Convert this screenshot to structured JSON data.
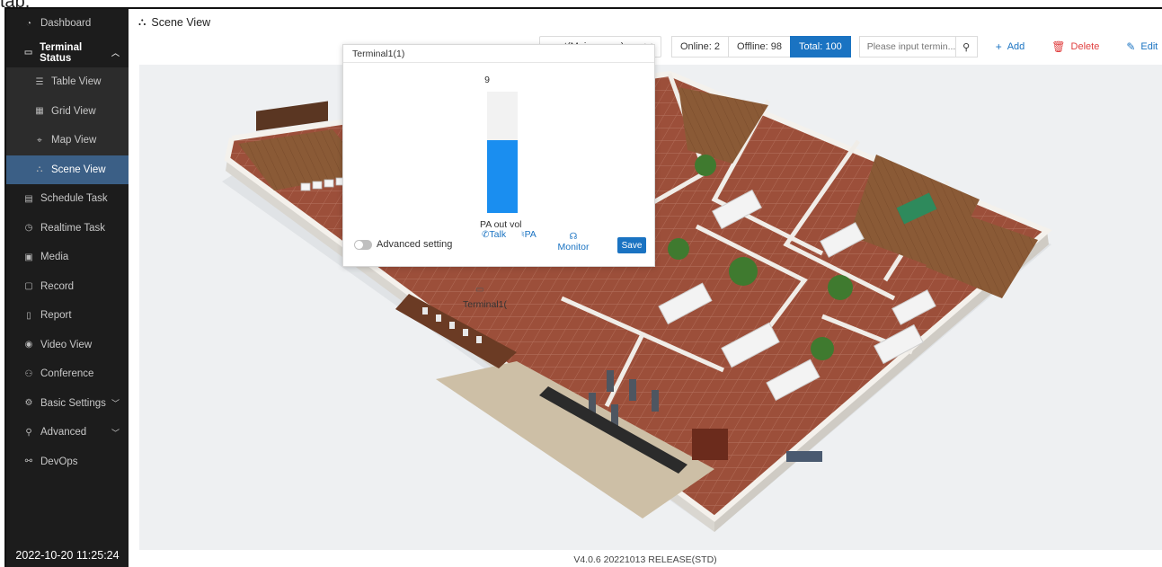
{
  "caption": "tab.",
  "sidebar": {
    "items": [
      {
        "label": "Dashboard",
        "icon": "dashboard-icon"
      },
      {
        "label": "Terminal Status",
        "icon": "monitor-icon"
      },
      {
        "label": "Table View",
        "icon": "list-icon"
      },
      {
        "label": "Grid View",
        "icon": "grid-icon"
      },
      {
        "label": "Map View",
        "icon": "map-pin-icon"
      },
      {
        "label": "Scene View",
        "icon": "scene-icon"
      },
      {
        "label": "Schedule Task",
        "icon": "calendar-icon"
      },
      {
        "label": "Realtime Task",
        "icon": "clock-icon"
      },
      {
        "label": "Media",
        "icon": "media-icon"
      },
      {
        "label": "Record",
        "icon": "file-icon"
      },
      {
        "label": "Report",
        "icon": "report-icon"
      },
      {
        "label": "Video View",
        "icon": "video-icon"
      },
      {
        "label": "Conference",
        "icon": "users-icon"
      },
      {
        "label": "Basic Settings",
        "icon": "settings-icon"
      },
      {
        "label": "Advanced",
        "icon": "advanced-icon"
      },
      {
        "label": "DevOps",
        "icon": "devops-icon"
      }
    ],
    "active": "Scene View",
    "clock": "2022-10-20 11:25:24"
  },
  "header": {
    "title": "Scene View"
  },
  "toolbar": {
    "scene_select": "root(Main scene)",
    "online": "Online: 2",
    "offline": "Offline: 98",
    "total": "Total: 100",
    "search_placeholder": "Please input termin...",
    "add": "Add",
    "delete": "Delete",
    "edit": "Edit"
  },
  "popup": {
    "title": "Terminal1(1)",
    "volume": "9",
    "volume_level": 0.6,
    "volume_label": "PA out vol",
    "advanced_setting": "Advanced setting",
    "talk": "Talk",
    "pa": "PA",
    "monitor": "Monitor",
    "save": "Save"
  },
  "marker": {
    "label": "Terminal1("
  },
  "footer": {
    "version": "V4.0.6 20221013 RELEASE(STD)"
  },
  "colors": {
    "sidebar_bg": "#1c1c1c",
    "active_item": "#3b5f86",
    "accent": "#1a73c2",
    "danger": "#e04040",
    "volume_fill": "#1a8ef0"
  }
}
